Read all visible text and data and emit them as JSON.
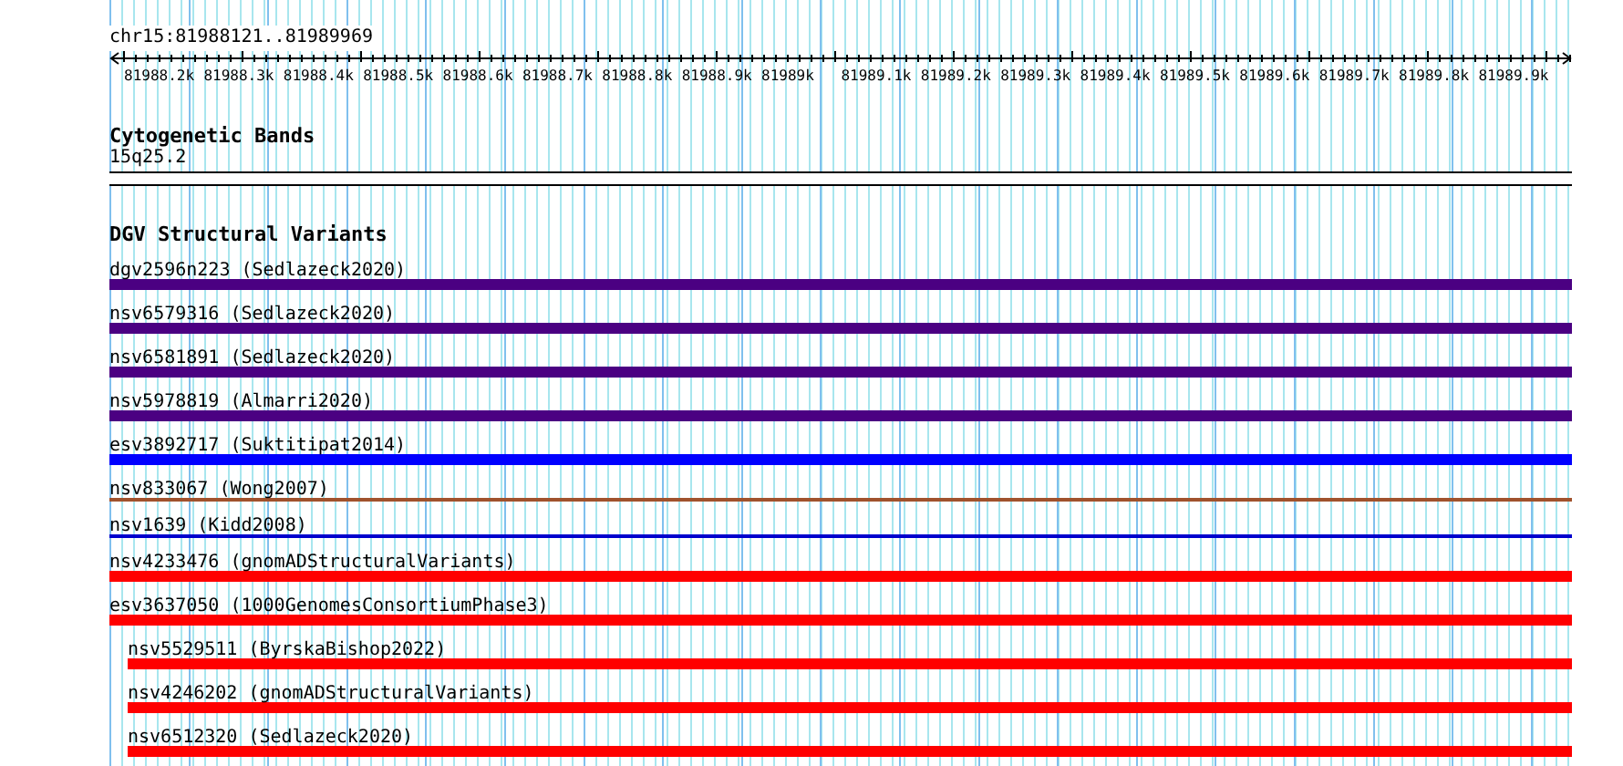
{
  "location": "chr15:81988121..81989969",
  "ruler": {
    "ticks": [
      "81988.2k",
      "81988.3k",
      "81988.4k",
      "81988.5k",
      "81988.6k",
      "81988.7k",
      "81988.8k",
      "81988.9k",
      "81989k",
      "81989.1k",
      "81989.2k",
      "81989.3k",
      "81989.4k",
      "81989.5k",
      "81989.6k",
      "81989.7k",
      "81989.8k",
      "81989.9k"
    ]
  },
  "tracks": [
    {
      "kind": "bands",
      "title": "Cytogenetic Bands",
      "features": [
        {
          "label": "15q25.2"
        }
      ]
    },
    {
      "kind": "variants",
      "title": "DGV Structural Variants",
      "features": [
        {
          "label": "dgv2596n223 (Sedlazeck2020)",
          "kind": "thick",
          "color": "#4b0082"
        },
        {
          "label": "nsv6579316 (Sedlazeck2020)",
          "kind": "thick",
          "color": "#4b0082"
        },
        {
          "label": "nsv6581891 (Sedlazeck2020)",
          "kind": "thick",
          "color": "#4b0082"
        },
        {
          "label": "nsv5978819 (Almarri2020)",
          "kind": "thick",
          "color": "#4b0082"
        },
        {
          "label": "esv3892717 (Suktitipat2014)",
          "kind": "thick",
          "color": "#0000ff"
        },
        {
          "label": "nsv833067 (Wong2007)",
          "kind": "thin",
          "color": "#a0522d"
        },
        {
          "label": "nsv1639 (Kidd2008)",
          "kind": "thin",
          "color": "#0000cd"
        },
        {
          "label": "nsv4233476 (gnomADStructuralVariants)",
          "kind": "thick",
          "color": "#ff0000"
        },
        {
          "label": "esv3637050 (1000GenomesConsortiumPhase3)",
          "kind": "thick",
          "color": "#ff0000",
          "children": [
            {
              "label": "nsv5529511 (ByrskaBishop2022)",
              "kind": "thick",
              "color": "#ff0000"
            },
            {
              "label": "nsv4246202 (gnomADStructuralVariants)",
              "kind": "thick",
              "color": "#ff0000"
            },
            {
              "label": "nsv6512320 (Sedlazeck2020)",
              "kind": "thick",
              "color": "#ff0000"
            }
          ]
        }
      ]
    }
  ]
}
